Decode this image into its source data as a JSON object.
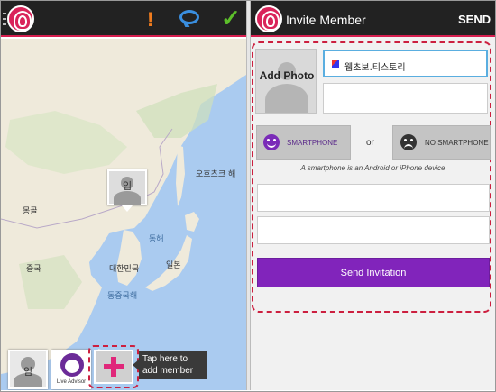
{
  "left_screen": {
    "header": {
      "logo": "fingerprint-logo-icon",
      "menu": "menu-lines-icon",
      "alert": {
        "icon": "exclamation-icon",
        "label": "!",
        "color": "#f07c1e"
      },
      "chat": {
        "icon": "chat-bubble-icon",
        "color": "#3a8fe0"
      },
      "confirm": {
        "icon": "checkmark-icon",
        "label": "✓",
        "color": "#5cbf2a"
      }
    },
    "map": {
      "labels": {
        "okhotsk": "오호츠크 해",
        "mongolia": "몽골",
        "east_sea": "동해",
        "korea": "대한민국",
        "japan": "일본",
        "china": "중국",
        "east_china_sea": "동중국해"
      },
      "pin": {
        "name": "임"
      }
    },
    "tray": {
      "member": {
        "name": "임"
      },
      "advisor": {
        "label": "Live Advisor"
      },
      "add_member": {
        "icon": "plus-icon",
        "color": "#e0287a"
      }
    },
    "tooltip": {
      "text": "Tap here to add member"
    }
  },
  "right_screen": {
    "header": {
      "title": "Invite Member",
      "send_label": "SEND"
    },
    "form": {
      "photo_label": "Add Photo",
      "name_value": "웹초보.티스토리",
      "smartphone_label": "SMARTPHONE",
      "or_label": "or",
      "no_smartphone_label": "NO SMARTPHONE",
      "hint": "A smartphone is an Android or iPhone device",
      "send_button": "Send Invitation"
    }
  },
  "colors": {
    "accent": "#d61e4f",
    "purple": "#8124bb",
    "highlight_dash": "#cc1f3f"
  }
}
